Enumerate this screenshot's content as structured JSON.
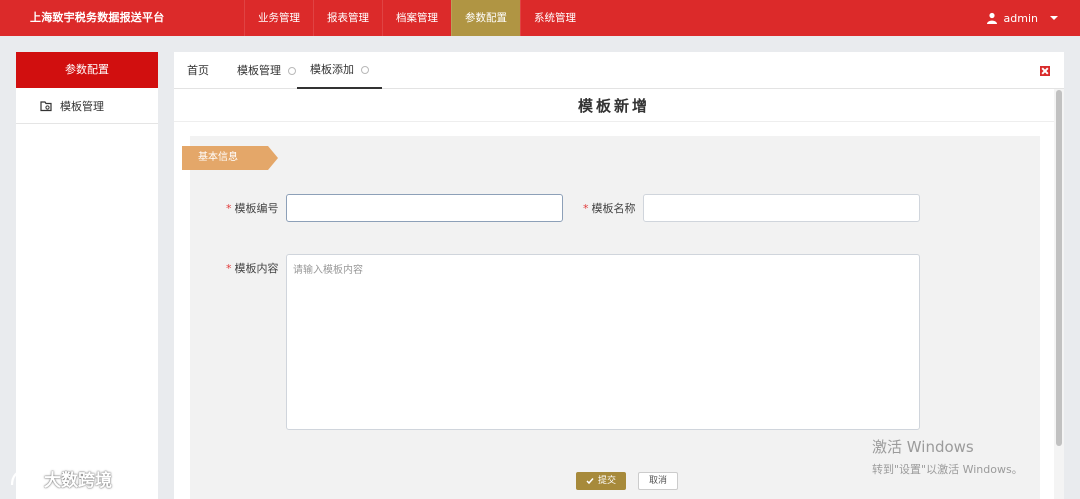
{
  "header": {
    "brand": "上海致宇税务数据报送平台",
    "nav": [
      "业务管理",
      "报表管理",
      "档案管理",
      "参数配置",
      "系统管理"
    ],
    "active_nav_index": 3,
    "user": "admin"
  },
  "sidebar": {
    "title": "参数配置",
    "items": [
      {
        "label": "模板管理",
        "icon": "folder-icon"
      }
    ]
  },
  "tabs": [
    {
      "label": "首页"
    },
    {
      "label": "模板管理"
    },
    {
      "label": "模板添加"
    }
  ],
  "active_tab_index": 2,
  "page": {
    "title": "模板新增"
  },
  "form": {
    "section": "基本信息",
    "required_mark": "*",
    "fields": {
      "code": {
        "label": "模板编号",
        "value": "",
        "placeholder": ""
      },
      "name": {
        "label": "模板名称",
        "value": "",
        "placeholder": ""
      },
      "content": {
        "label": "模板内容",
        "value": "",
        "placeholder": "请输入模板内容"
      }
    },
    "submit_label": "提交",
    "cancel_label": "取消"
  },
  "colors": {
    "header_bg": "#dc2a2a",
    "nav_active": "#b09543",
    "sidebar_head": "#d10f0f",
    "section_flag": "#e4a769",
    "primary_button": "#a78a3b"
  },
  "overlay": {
    "windows_activation_title": "激活 Windows",
    "windows_activation_hint": "转到\"设置\"以激活 Windows。",
    "brand_watermark": "大数跨境"
  }
}
